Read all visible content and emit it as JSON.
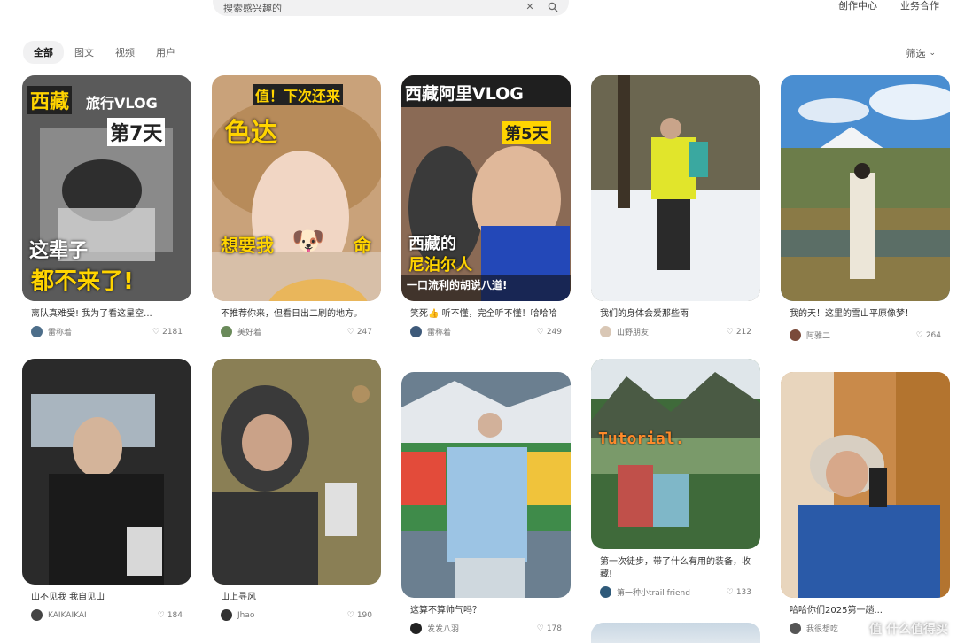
{
  "search": {
    "value": "搜索感兴趣的",
    "clear_icon": "close-icon",
    "search_icon": "search-icon"
  },
  "toplinks": [
    "创作中心",
    "业务合作"
  ],
  "filters": {
    "tabs": [
      "全部",
      "图文",
      "视频",
      "用户"
    ],
    "active": "全部"
  },
  "sort": {
    "label": "筛选"
  },
  "colors": {
    "accent": "#ff2442",
    "chip_bg": "#f1f1f2"
  },
  "cards": [
    {
      "overlay": [
        "西藏",
        "旅行VLOG",
        "第7天",
        "这辈子",
        "都不来了!"
      ],
      "caption": "离队真难受! 我为了看这星空...",
      "author": "雷称着",
      "likes": "2181"
    },
    {
      "overlay": [
        "值！下次还来",
        "色达",
        "想要我",
        "命"
      ],
      "caption": "不推荐你来，但看日出二刷的地方。",
      "author": "美好着",
      "likes": "247"
    },
    {
      "overlay": [
        "西藏阿里VLOG",
        "第5天",
        "西藏的",
        "尼泊尔人",
        "一口流利的胡说八道!"
      ],
      "caption": "笑死👍 听不懂，完全听不懂！哈哈哈",
      "author": "雷称着",
      "likes": "249"
    },
    {
      "overlay": [],
      "caption": "我们的身体会爱那些雨",
      "author": "山野朋友",
      "likes": "212"
    },
    {
      "overlay": [],
      "caption": "我的天！这里的雪山平原像梦！",
      "author": "阿雅二",
      "likes": "264"
    },
    {
      "overlay": [],
      "caption": "山不见我 我自见山",
      "author": "KAIKAIKAI",
      "likes": "184"
    },
    {
      "overlay": [],
      "caption": "山上寻风",
      "author": "Jhao",
      "likes": "190"
    },
    {
      "overlay": [],
      "caption": "这算不算帅气吗？",
      "author": "发发八羽",
      "likes": "178"
    },
    {
      "overlay": [
        "Tutorial."
      ],
      "caption": "第一次徒步，带了什么有用的装备，收藏!",
      "author": "第一种小trail friend",
      "likes": "133"
    },
    {
      "overlay": [],
      "caption": "哈哈你们2025第一趟...",
      "author": "我很想吃",
      "likes": ""
    }
  ],
  "watermark": "值 什么值得买"
}
